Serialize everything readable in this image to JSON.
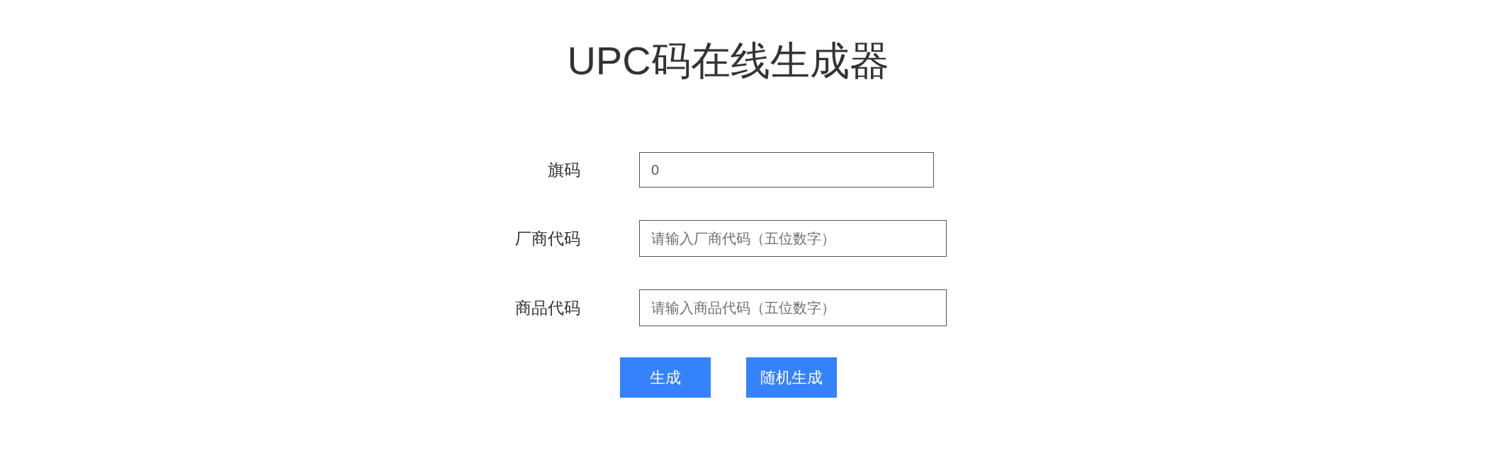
{
  "title": "UPC码在线生成器",
  "fields": [
    {
      "label": "旗码",
      "value": "0"
    },
    {
      "label": "厂商代码",
      "placeholder": "请输入厂商代码（五位数字）"
    },
    {
      "label": "商品代码",
      "placeholder": "请输入商品代码（五位数字）"
    }
  ],
  "buttons": [
    "生成",
    "随机生成"
  ]
}
